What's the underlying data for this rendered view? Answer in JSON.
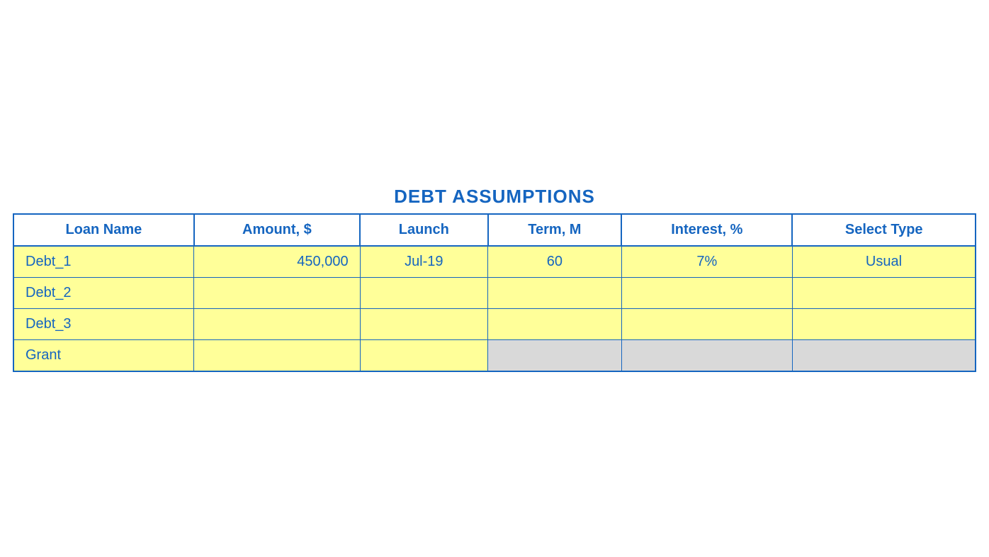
{
  "title": "DEBT ASSUMPTIONS",
  "table": {
    "headers": [
      "Loan Name",
      "Amount, $",
      "Launch",
      "Term, M",
      "Interest, %",
      "Select Type"
    ],
    "rows": [
      {
        "loan_name": "Debt_1",
        "amount": "450,000",
        "launch": "Jul-19",
        "term": "60",
        "interest": "7%",
        "select_type": "Usual",
        "gray_cells": false
      },
      {
        "loan_name": "Debt_2",
        "amount": "",
        "launch": "",
        "term": "",
        "interest": "",
        "select_type": "",
        "gray_cells": false
      },
      {
        "loan_name": "Debt_3",
        "amount": "",
        "launch": "",
        "term": "",
        "interest": "",
        "select_type": "",
        "gray_cells": false
      },
      {
        "loan_name": "Grant",
        "amount": "",
        "launch": "",
        "term": "",
        "interest": "",
        "select_type": "",
        "gray_cells": true
      }
    ]
  }
}
